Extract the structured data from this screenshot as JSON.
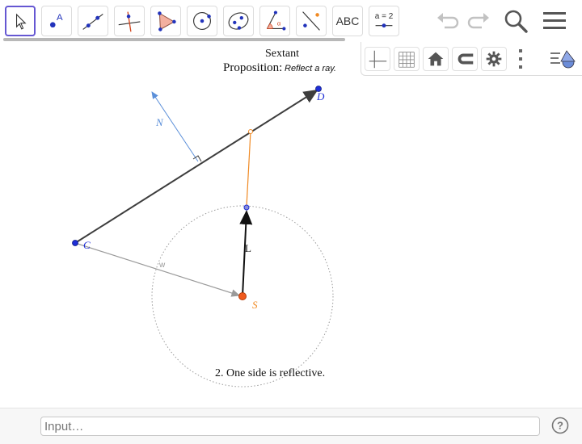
{
  "toolbar": {
    "tools": [
      {
        "name": "move-tool",
        "active": true
      },
      {
        "name": "point-tool"
      },
      {
        "name": "line-tool"
      },
      {
        "name": "perpendicular-line-tool"
      },
      {
        "name": "polygon-tool"
      },
      {
        "name": "circle-center-point-tool"
      },
      {
        "name": "ellipse-tool"
      },
      {
        "name": "angle-tool"
      },
      {
        "name": "reflect-about-line-tool"
      },
      {
        "name": "text-tool",
        "label": "ABC"
      },
      {
        "name": "slider-tool",
        "label": "a = 2"
      }
    ]
  },
  "header": {
    "undo_icon": "undo-icon",
    "redo_icon": "redo-icon",
    "search_icon": "search-icon",
    "menu_icon": "hamburger-menu-icon"
  },
  "graphics_toolbar": {
    "buttons": [
      "axes-icon",
      "grid-icon",
      "home-icon",
      "magnet-icon",
      "gear-icon",
      "more-vertical-icon"
    ],
    "style_bar_icon": "style-bar-toggle-icon"
  },
  "construction": {
    "title": "Sextant",
    "proposition_label": "Proposition:",
    "proposition_text": "Reflect a ray.",
    "note": "2. One side is reflective.",
    "points": {
      "C": "C",
      "D": "D",
      "S": "S",
      "N": "N",
      "L": "L",
      "w": "w"
    },
    "colors": {
      "mirror": "#3d3d3d",
      "normal": "#5b8fd9",
      "reflected": "#f08a24",
      "incident": "#9a9a9a",
      "point_blue": "#1f2fd6",
      "point_orange": "#f05a1e"
    }
  },
  "input_bar": {
    "placeholder": "Input…",
    "help_icon": "help-icon"
  }
}
